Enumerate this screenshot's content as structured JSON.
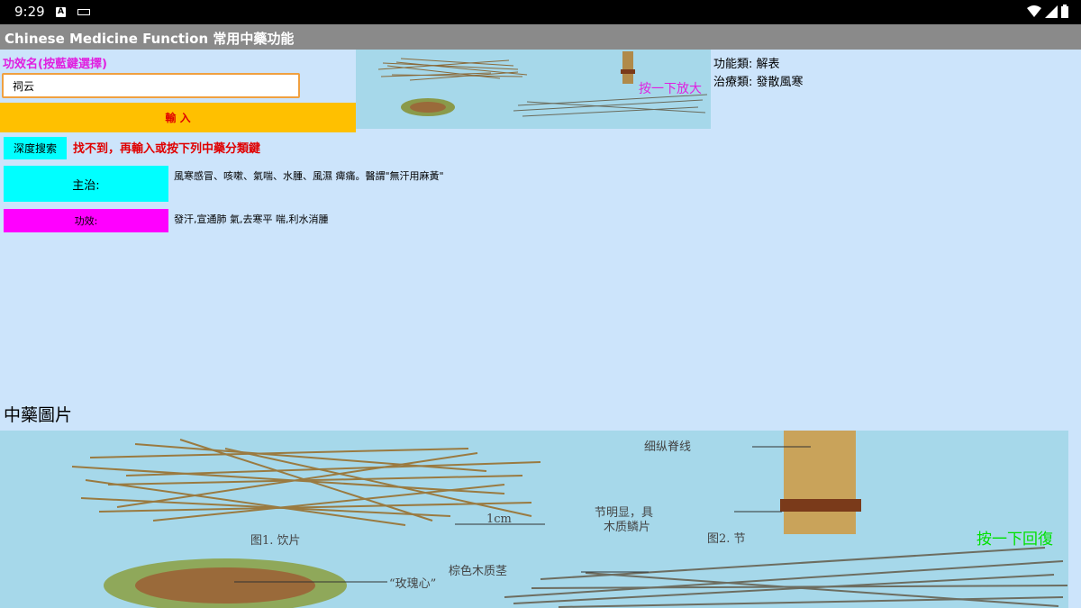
{
  "status_bar": {
    "time": "9:29"
  },
  "app": {
    "title": "Chinese Medicine Function 常用中藥功能"
  },
  "search": {
    "label": "功效名(按藍鍵選擇)",
    "value": "祠云",
    "input_button": "輸 入",
    "deep_search_button": "深度搜索",
    "hint": "找不到，再輸入或按下列中藥分類鍵"
  },
  "details": {
    "main_treatment_label": "主治:",
    "main_treatment_text": "風寒感冒、咳嗽、氣喘、水腫、風濕 痺痛。醫謂\"無汗用麻黃\"",
    "efficacy_label": "功效:",
    "efficacy_text": "發汗,宣通肺 氣,去寒平 喘,利水消腫"
  },
  "thumbnail": {
    "zoom_hint": "按一下放大"
  },
  "category": {
    "function_class": "功能類: 解表",
    "treatment_class": "治療類: 發散風寒"
  },
  "image_section": {
    "title": "中藥圖片",
    "restore_hint": "按一下回復",
    "labels": {
      "fig1": "图1. 饮片",
      "fig2": "图2. 节",
      "vein": "细纵脊线",
      "node": "节明显，具",
      "node2": "木质鳞片",
      "stem": "棕色木质茎",
      "heart": "“玫瑰心”",
      "scale": "1cm"
    }
  },
  "colors": {
    "background": "#cce4fb",
    "accent_magenta": "#e020e0",
    "accent_cyan": "#00ffff",
    "accent_yellow": "#ffc000",
    "alert_red": "#e00000",
    "restore_green": "#00e000"
  }
}
